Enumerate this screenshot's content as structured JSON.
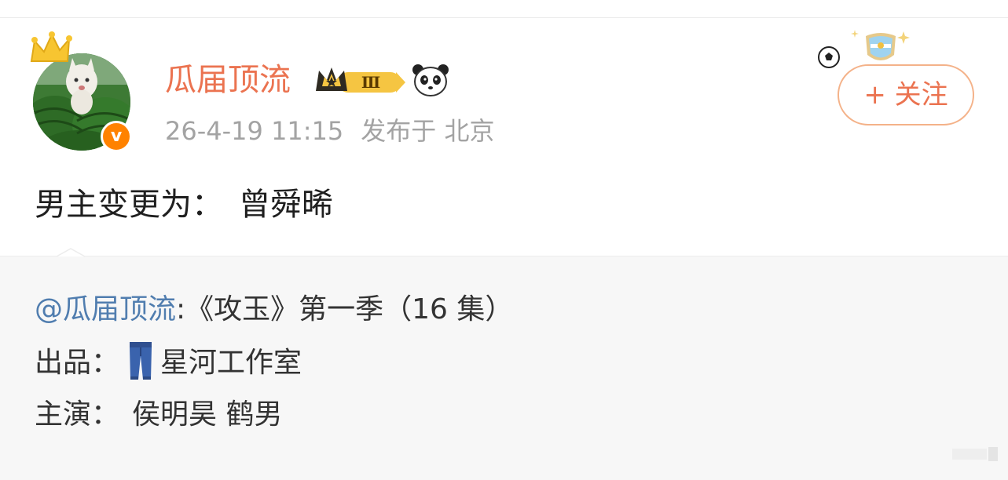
{
  "post": {
    "username": "瓜届顶流",
    "vip_level": "Ⅲ",
    "timestamp": "26-4-19 11:15",
    "location": "发布于 北京",
    "follow_label": "+ 关注",
    "text_label": "男主变更为：",
    "text_value": "曾舜晞"
  },
  "repost": {
    "mention": "@瓜届顶流",
    "title": ":《攻玉》第一季（16 集）",
    "producer_label": "出品：",
    "producer_value": "星河工作室",
    "cast_label": "主演：",
    "cast_value": "侯明昊 鹤男"
  },
  "icons": {
    "crown": "crown-icon",
    "verified": "verified-badge-icon",
    "vip": "vip-crown-badge-icon",
    "panda": "panda-icon",
    "ball": "soccer-ball-icon",
    "shield": "shield-badge-icon",
    "jeans": "jeans-icon"
  },
  "colors": {
    "username": "#eb7350",
    "follow_border": "#f4b289",
    "mention": "#507daf",
    "meta": "#a3a3a3",
    "verified": "#ff8200",
    "repost_bg": "#f7f7f7"
  }
}
